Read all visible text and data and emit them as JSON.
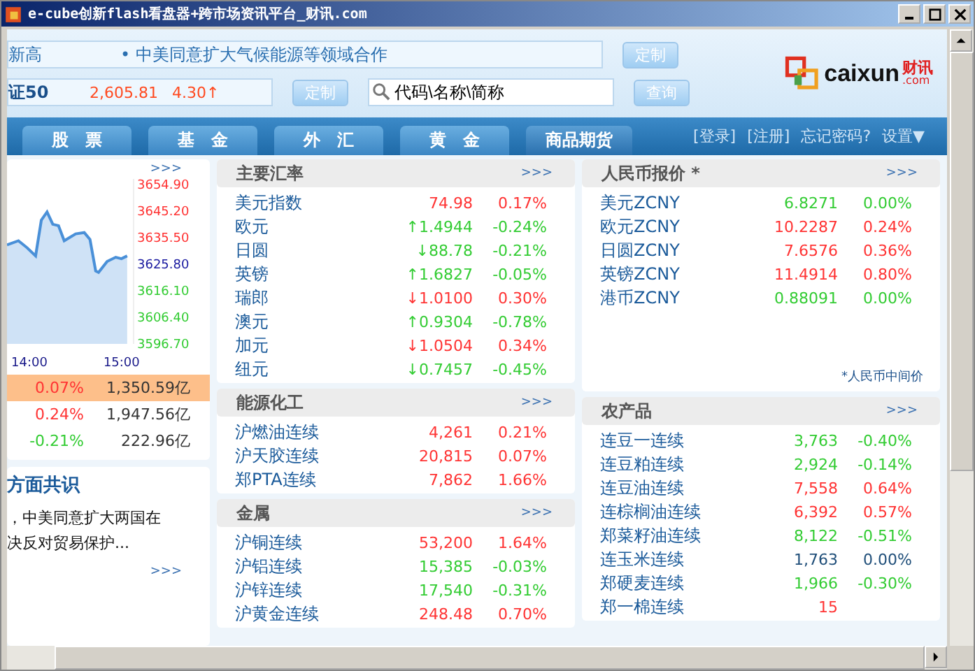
{
  "window": {
    "title": "e-cube创新flash看盘器+跨市场资讯平台_财讯.com"
  },
  "ticker": {
    "text_1": "新高",
    "headline": "• 中美同意扩大气候能源等领域合作",
    "button": "定制"
  },
  "quote_bar": {
    "index": "证50",
    "value": "2,605.81",
    "change": "4.30↑",
    "button": "定制"
  },
  "search": {
    "placeholder": "代码\\名称\\简称",
    "button": "查询"
  },
  "logo": {
    "name": "caixun",
    "cn": "财讯",
    "suffix": ".com"
  },
  "tabs": [
    {
      "label": "股　票",
      "selected": false
    },
    {
      "label": "基　金",
      "selected": false
    },
    {
      "label": "外　汇",
      "selected": false
    },
    {
      "label": "黄　金",
      "selected": false
    },
    {
      "label": "商品期货",
      "selected": true
    }
  ],
  "account_links": [
    "[登录]",
    "[注册]",
    "忘记密码?",
    "设置▼"
  ],
  "index_panel": {
    "more": ">>>",
    "y_labels": [
      {
        "text": "3654.90",
        "color": "#ff3333"
      },
      {
        "text": "3645.20",
        "color": "#ff3333"
      },
      {
        "text": "3635.50",
        "color": "#ff3333"
      },
      {
        "text": "3625.80",
        "color": "#1a1aa0"
      },
      {
        "text": "3616.10",
        "color": "#33cc33"
      },
      {
        "text": "3606.40",
        "color": "#33cc33"
      },
      {
        "text": "3596.70",
        "color": "#33cc33"
      }
    ],
    "x_labels": [
      "14:00",
      "15:00"
    ],
    "rows": [
      {
        "change": "0.07%",
        "amount": "1,350.59亿",
        "color": "#ff3333",
        "selected": true
      },
      {
        "change": "0.24%",
        "amount": "1,947.56亿",
        "color": "#ff3333",
        "selected": false
      },
      {
        "change": "-0.21%",
        "amount": "222.96亿",
        "color": "#33cc33",
        "selected": false
      }
    ]
  },
  "news": {
    "title": "方面共识",
    "lines": [
      "，中美同意扩大两国在",
      "决反对贸易保护..."
    ],
    "more": ">>>"
  },
  "columns": [
    {
      "panels": [
        {
          "title": "主要汇率",
          "more": ">>>",
          "rows": [
            {
              "name": "美元指数",
              "value": "74.98",
              "change": "0.17%",
              "color": "#ff3333"
            },
            {
              "name": "欧元",
              "value": "↑1.4944",
              "change": "-0.24%",
              "color": "#33cc33"
            },
            {
              "name": "日圆",
              "value": "↓88.78",
              "change": "-0.21%",
              "color": "#33cc33"
            },
            {
              "name": "英镑",
              "value": "↑1.6827",
              "change": "-0.05%",
              "color": "#33cc33"
            },
            {
              "name": "瑞郎",
              "value": "↓1.0100",
              "change": "0.30%",
              "color": "#ff3333"
            },
            {
              "name": "澳元",
              "value": "↑0.9304",
              "change": "-0.78%",
              "color": "#33cc33"
            },
            {
              "name": "加元",
              "value": "↓1.0504",
              "change": "0.34%",
              "color": "#ff3333"
            },
            {
              "name": "纽元",
              "value": "↓0.7457",
              "change": "-0.45%",
              "color": "#33cc33"
            }
          ]
        },
        {
          "title": "能源化工",
          "more": ">>>",
          "rows": [
            {
              "name": "沪燃油连续",
              "value": "4,261",
              "change": "0.21%",
              "color": "#ff3333"
            },
            {
              "name": "沪天胶连续",
              "value": "20,815",
              "change": "0.07%",
              "color": "#ff3333"
            },
            {
              "name": "郑PTA连续",
              "value": "7,862",
              "change": "1.66%",
              "color": "#ff3333"
            }
          ]
        },
        {
          "title": "金属",
          "more": ">>>",
          "rows": [
            {
              "name": "沪铜连续",
              "value": "53,200",
              "change": "1.64%",
              "color": "#ff3333"
            },
            {
              "name": "沪铝连续",
              "value": "15,385",
              "change": "-0.03%",
              "color": "#33cc33"
            },
            {
              "name": "沪锌连续",
              "value": "17,540",
              "change": "-0.31%",
              "color": "#33cc33"
            },
            {
              "name": "沪黄金连续",
              "value": "248.48",
              "change": "0.70%",
              "color": "#ff3333"
            }
          ]
        }
      ]
    },
    {
      "panels": [
        {
          "title": "人民币报价 *",
          "more": ">>>",
          "footnote": "*人民币中间价",
          "rows": [
            {
              "name": "美元ZCNY",
              "value": "6.8271",
              "change": "0.00%",
              "color": "#33cc33"
            },
            {
              "name": "欧元ZCNY",
              "value": "10.2287",
              "change": "0.24%",
              "color": "#ff3333"
            },
            {
              "name": "日圆ZCNY",
              "value": "7.6576",
              "change": "0.36%",
              "color": "#ff3333"
            },
            {
              "name": "英镑ZCNY",
              "value": "11.4914",
              "change": "0.80%",
              "color": "#ff3333"
            },
            {
              "name": "港币ZCNY",
              "value": "0.88091",
              "change": "0.00%",
              "color": "#33cc33"
            }
          ]
        },
        {
          "title": "农产品",
          "more": ">>>",
          "rows": [
            {
              "name": "连豆一连续",
              "value": "3,763",
              "change": "-0.40%",
              "color": "#33cc33"
            },
            {
              "name": "连豆粕连续",
              "value": "2,924",
              "change": "-0.14%",
              "color": "#33cc33"
            },
            {
              "name": "连豆油连续",
              "value": "7,558",
              "change": "0.64%",
              "color": "#ff3333"
            },
            {
              "name": "连棕榈油连续",
              "value": "6,392",
              "change": "0.57%",
              "color": "#ff3333"
            },
            {
              "name": "郑菜籽油连续",
              "value": "8,122",
              "change": "-0.51%",
              "color": "#33cc33"
            },
            {
              "name": "连玉米连续",
              "value": "1,763",
              "change": "0.00%",
              "color": "#1f4e79"
            },
            {
              "name": "郑硬麦连续",
              "value": "1,966",
              "change": "-0.30%",
              "color": "#33cc33"
            },
            {
              "name": "郑一棉连续",
              "value": "15",
              "color": "#ff3333"
            }
          ]
        }
      ]
    }
  ]
}
